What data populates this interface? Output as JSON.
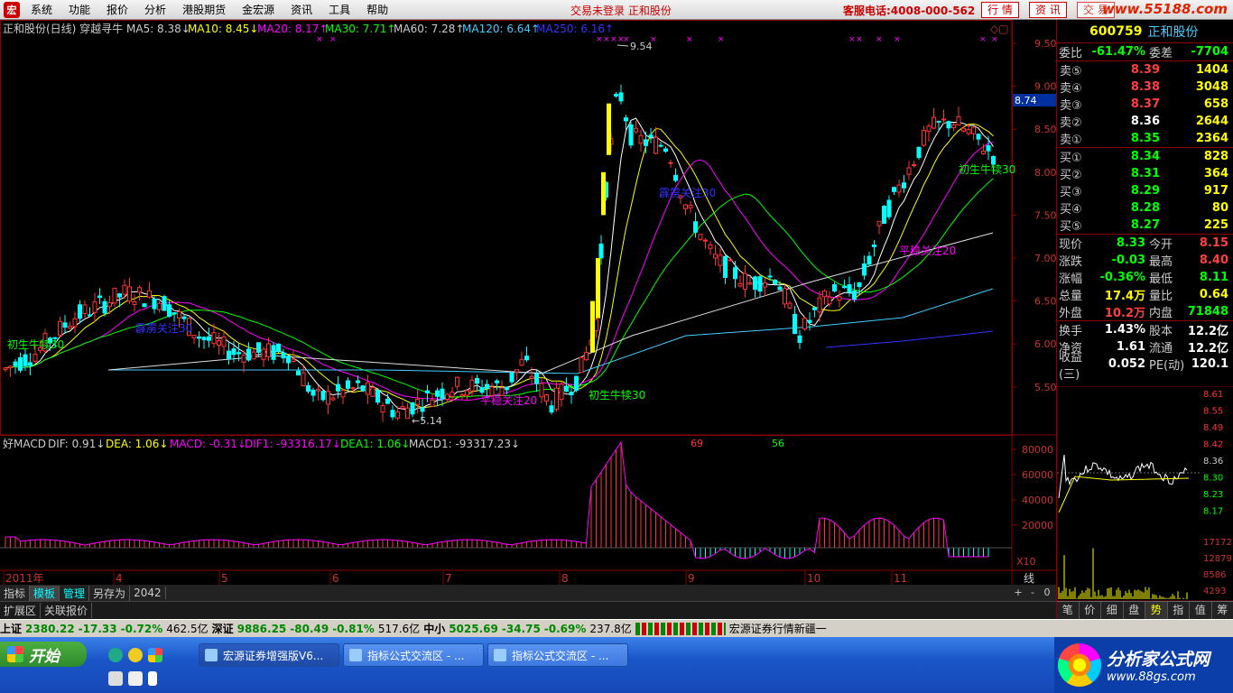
{
  "menubar": {
    "items": [
      "系统",
      "功能",
      "报价",
      "分析",
      "港股期货",
      "金宏源",
      "资讯",
      "工具",
      "帮助"
    ],
    "notice": "交易未登录 正和股份",
    "hotline": "客服电话:4008-000-562",
    "buttons": [
      "行 情",
      "资 讯",
      "交 易"
    ],
    "brand": "www.55188.com"
  },
  "main_chart": {
    "header": {
      "title": "正和股份(日线) 穿越寻牛",
      "ma5": "MA5: 8.38↓",
      "ma10": "MA10: 8.45↓",
      "ma20": "MA20: 8.17↑",
      "ma30": "MA30: 7.71↑",
      "ma60": "MA60: 7.28↑",
      "ma120": "MA120: 6.64↑",
      "ma250": "MA250: 6.16↑"
    },
    "price_axis": [
      "9.50",
      "9.00",
      "8.50",
      "8.00",
      "7.50",
      "7.00",
      "6.50",
      "6.00",
      "5.50"
    ],
    "current_price_tag": "8.74",
    "annotations": {
      "high": "9.54",
      "low": "←5.14",
      "n69": "69",
      "n56": "56",
      "a1": "初生牛犊30",
      "a2": "初生牛犊30",
      "a3": "初生牛犊30",
      "a4": "霹雳关注30",
      "a5": "霹雳关注30",
      "a6": "平稳关注20",
      "a7": "平稳关注20"
    }
  },
  "macd_chart": {
    "header": {
      "name": "好MACD",
      "dif": "DIF: 0.91↓",
      "dea": "DEA: 1.06↓",
      "macd": "MACD: -0.31↓",
      "dif1": "DIF1: -93316.17↓",
      "dea1": "DEA1: 1.06↓",
      "macd1": "MACD1: -93317.23↓"
    },
    "axis": [
      "80000",
      "60000",
      "40000",
      "20000"
    ],
    "scale": "X10"
  },
  "date_axis": [
    "2011年",
    "4",
    "5",
    "6",
    "7",
    "8",
    "9",
    "10",
    "11"
  ],
  "bottom_tabs": [
    "指标",
    "模板",
    "管理",
    "另存为",
    "2042"
  ],
  "bottom_tabs2": [
    "扩展区",
    "关联报价"
  ],
  "view_controls": [
    "线",
    "+",
    "-",
    "0"
  ],
  "chart_data": {
    "type": "candlestick",
    "title": "正和股份(日线) 穿越寻牛",
    "x": [
      "2011年",
      "4",
      "5",
      "6",
      "7",
      "8",
      "9",
      "10",
      "11"
    ],
    "ylim": [
      5.1,
      9.6
    ],
    "high": 9.54,
    "low": 5.14,
    "last": 8.33
  },
  "quote": {
    "code": "600759",
    "name": "正和股份",
    "weibi": {
      "label": "委比",
      "value": "-61.47%",
      "label2": "委差",
      "value2": "-7704"
    },
    "asks": [
      {
        "label": "卖⑤",
        "price": "8.39",
        "vol": "1404"
      },
      {
        "label": "卖④",
        "price": "8.38",
        "vol": "3048"
      },
      {
        "label": "卖③",
        "price": "8.37",
        "vol": "658"
      },
      {
        "label": "卖②",
        "price": "8.36",
        "vol": "2644"
      },
      {
        "label": "卖①",
        "price": "8.35",
        "vol": "2364"
      }
    ],
    "bids": [
      {
        "label": "买①",
        "price": "8.34",
        "vol": "828"
      },
      {
        "label": "买②",
        "price": "8.31",
        "vol": "364"
      },
      {
        "label": "买③",
        "price": "8.29",
        "vol": "917"
      },
      {
        "label": "买④",
        "price": "8.28",
        "vol": "80"
      },
      {
        "label": "买⑤",
        "price": "8.27",
        "vol": "225"
      }
    ],
    "stats": [
      {
        "l1": "现价",
        "v1": "8.33",
        "l2": "今开",
        "v2": "8.15",
        "c1": "green",
        "c2": "red"
      },
      {
        "l1": "涨跌",
        "v1": "-0.03",
        "l2": "最高",
        "v2": "8.40",
        "c1": "green",
        "c2": "red"
      },
      {
        "l1": "涨幅",
        "v1": "-0.36%",
        "l2": "最低",
        "v2": "8.11",
        "c1": "green",
        "c2": "green"
      },
      {
        "l1": "总量",
        "v1": "17.4万",
        "l2": "量比",
        "v2": "0.64",
        "c1": "yel",
        "c2": "yel"
      },
      {
        "l1": "外盘",
        "v1": "10.2万",
        "l2": "内盘",
        "v2": "71848",
        "c1": "red",
        "c2": "green"
      }
    ],
    "stats2": [
      {
        "l1": "换手",
        "v1": "1.43%",
        "l2": "股本",
        "v2": "12.2亿"
      },
      {
        "l1": "净资",
        "v1": "1.61",
        "l2": "流通",
        "v2": "12.2亿"
      },
      {
        "l1": "收益(三)",
        "v1": "0.052",
        "l2": "PE(动)",
        "v2": "120.1"
      }
    ],
    "tick_axis": [
      "8.61",
      "8.55",
      "8.49",
      "8.42",
      "8.36",
      "8.30",
      "8.23",
      "8.17",
      "17172",
      "12879",
      "8586",
      "4293"
    ],
    "tabs": [
      "笔",
      "价",
      "细",
      "盘",
      "势",
      "指",
      "值",
      "筹"
    ]
  },
  "statusbar": {
    "sh": {
      "name": "上证",
      "val": "2380.22",
      "chg": "-17.33",
      "pct": "-0.72%",
      "amt": "462.5亿"
    },
    "sz": {
      "name": "深证",
      "val": "9886.25",
      "chg": "-80.49",
      "pct": "-0.81%",
      "amt": "517.6亿"
    },
    "zx": {
      "name": "中小",
      "val": "5025.69",
      "chg": "-34.75",
      "pct": "-0.69%",
      "amt": "237.8亿"
    },
    "ticker": "宏源证券行情新疆一"
  },
  "taskbar": {
    "start": "开始",
    "tasks": [
      "宏源证券增强版V6...",
      "指标公式交流区 - ...",
      "指标公式交流区 - ..."
    ],
    "brand1": "分析家公式网",
    "brand2": "www.88gs.com"
  }
}
